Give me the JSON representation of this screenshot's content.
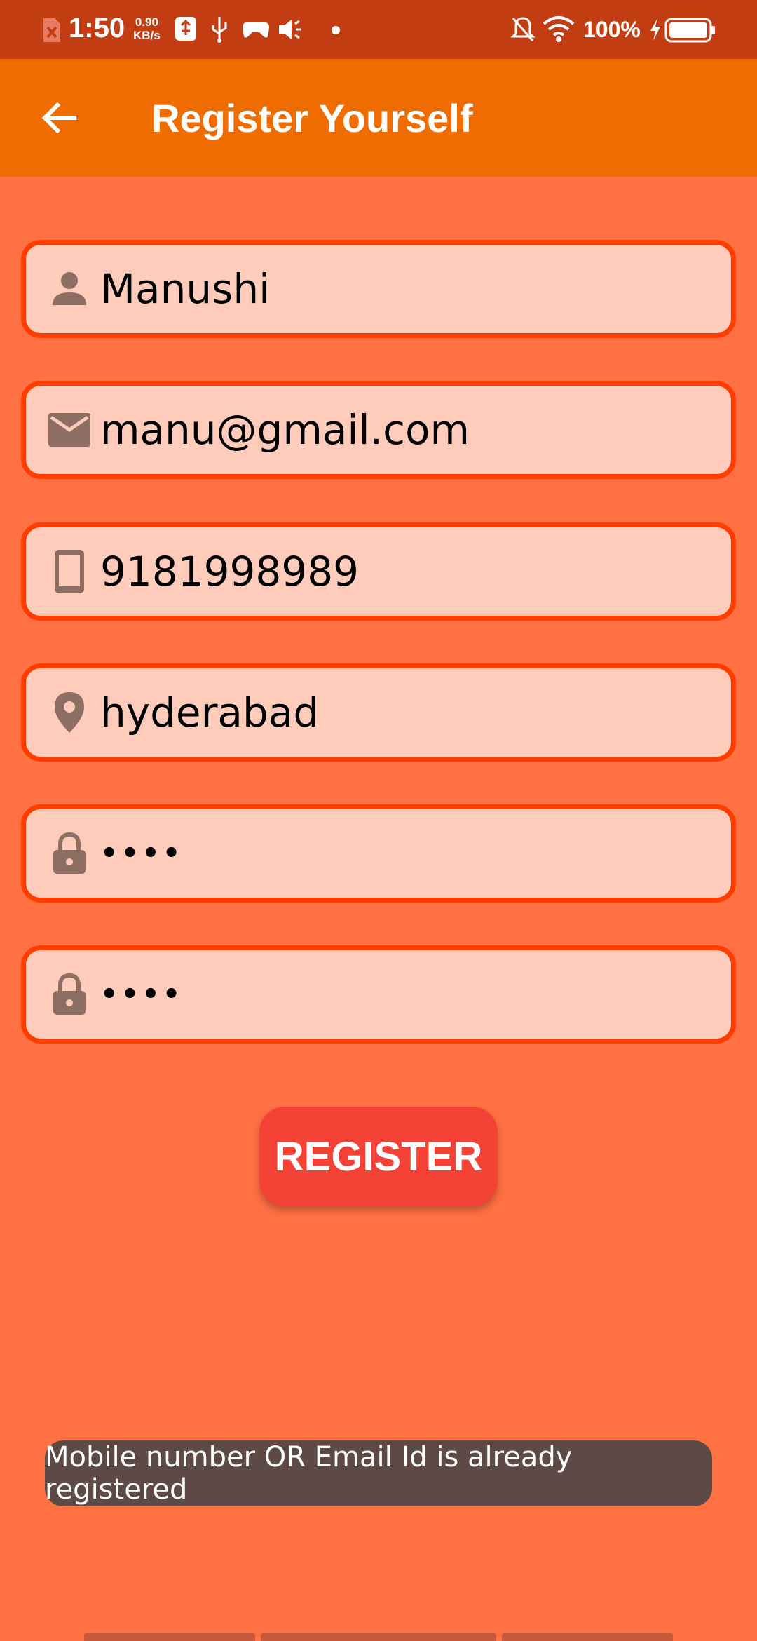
{
  "status_bar": {
    "time": "1:50",
    "speed_value": "0.90",
    "speed_unit": "KB/s",
    "battery": "100%"
  },
  "app_bar": {
    "title": "Register Yourself"
  },
  "form": {
    "name": "Manushi",
    "email": "manu@gmail.com",
    "mobile": "9181998989",
    "city": "hyderabad",
    "password": "••••",
    "confirm_password": "••••"
  },
  "register_label": "REGISTER",
  "toast": "Mobile number OR Email Id is already registered",
  "colors": {
    "status_bar": "#c23d12",
    "app_bar": "#ef6c00",
    "background": "#ff7043",
    "field_fill": "#ffccbc",
    "field_border": "#ff3d00",
    "button": "#f44336",
    "toast": "#5d4a44"
  }
}
